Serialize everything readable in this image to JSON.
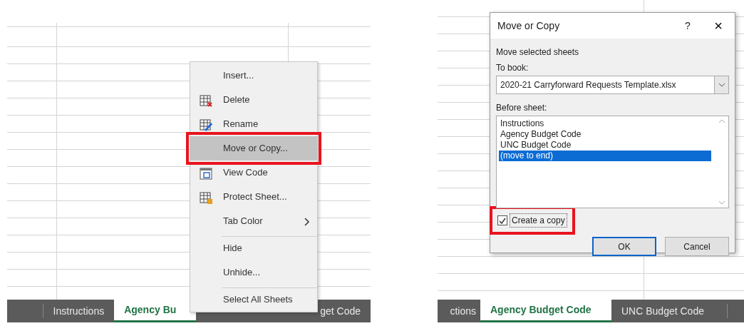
{
  "left_panel": {
    "sheet_tabs": [
      {
        "label": "Instructions",
        "selected": false
      },
      {
        "label": "Agency Bu",
        "selected": true
      },
      {
        "label": "get Code",
        "selected": false
      }
    ],
    "context_menu": {
      "items": [
        {
          "label": "Insert...",
          "has_icon": false,
          "highlighted": false,
          "submenu": false,
          "separator_before": false,
          "callout": false
        },
        {
          "label": "Delete",
          "has_icon": true,
          "highlighted": false,
          "submenu": false,
          "separator_before": false,
          "callout": false
        },
        {
          "label": "Rename",
          "has_icon": true,
          "highlighted": false,
          "submenu": false,
          "separator_before": false,
          "callout": false
        },
        {
          "label": "Move or Copy...",
          "has_icon": false,
          "highlighted": true,
          "submenu": false,
          "separator_before": false,
          "callout": true
        },
        {
          "label": "View Code",
          "has_icon": true,
          "highlighted": false,
          "submenu": false,
          "separator_before": false,
          "callout": false
        },
        {
          "label": "Protect Sheet...",
          "has_icon": true,
          "highlighted": false,
          "submenu": false,
          "separator_before": false,
          "callout": false
        },
        {
          "label": "Tab Color",
          "has_icon": false,
          "highlighted": false,
          "submenu": true,
          "separator_before": false,
          "callout": false
        },
        {
          "label": "Hide",
          "has_icon": false,
          "highlighted": false,
          "submenu": false,
          "separator_before": true,
          "callout": false
        },
        {
          "label": "Unhide...",
          "has_icon": false,
          "highlighted": false,
          "submenu": false,
          "separator_before": false,
          "callout": false
        },
        {
          "label": "Select All Sheets",
          "has_icon": false,
          "highlighted": false,
          "submenu": false,
          "separator_before": true,
          "callout": false
        }
      ]
    }
  },
  "right_panel": {
    "dialog": {
      "title": "Move or Copy",
      "help": "?",
      "close": "×",
      "heading": "Move selected sheets",
      "to_book_label": "To book:",
      "to_book_value": "2020-21 Carryforward Requests Template.xlsx",
      "before_sheet_label": "Before sheet:",
      "before_sheet_items": [
        {
          "label": "Instructions",
          "selected": false
        },
        {
          "label": "Agency Budget Code",
          "selected": false
        },
        {
          "label": "UNC Budget Code",
          "selected": false
        },
        {
          "label": "(move to end)",
          "selected": true
        }
      ],
      "create_copy": {
        "label": "Create a copy",
        "checked": true,
        "callout": true
      },
      "buttons": [
        {
          "label": "OK",
          "default": true
        },
        {
          "label": "Cancel",
          "default": false
        }
      ]
    },
    "sheet_tabs": [
      {
        "label": "ctions",
        "selected": false
      },
      {
        "label": "Agency Budget Code",
        "selected": true
      },
      {
        "label": "UNC Budget Code",
        "selected": false
      }
    ]
  }
}
